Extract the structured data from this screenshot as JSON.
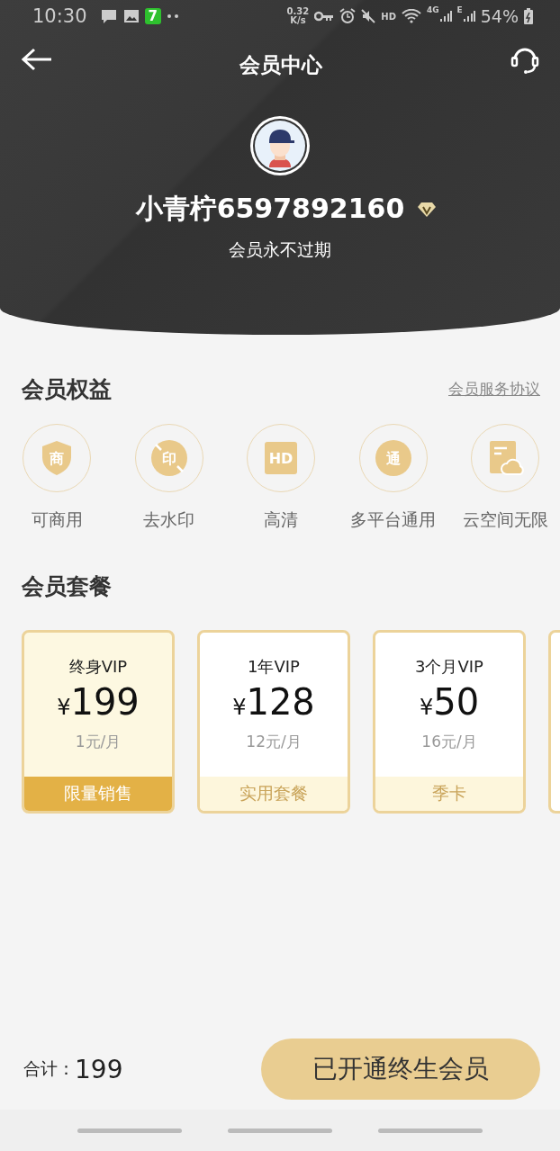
{
  "status_bar": {
    "time": "10:30",
    "notif_badge": "7",
    "speed": "0.32",
    "speed_unit": "K/s",
    "hd": "HD",
    "net": "4G",
    "net2": "E",
    "battery": "54%"
  },
  "header": {
    "title": "会员中心"
  },
  "profile": {
    "name": "小青柠6597892160",
    "expiry": "会员永不过期"
  },
  "benefits": {
    "title": "会员权益",
    "agreement_link": "会员服务协议",
    "items": [
      {
        "kind": "shield",
        "icon_text": "商",
        "label": "可商用"
      },
      {
        "kind": "nomark",
        "icon_text": "印",
        "label": "去水印"
      },
      {
        "kind": "square",
        "icon_text": "HD",
        "label": "高清"
      },
      {
        "kind": "circle",
        "icon_text": "通",
        "label": "多平台通用"
      },
      {
        "kind": "cloud",
        "label": "云空间无限"
      }
    ]
  },
  "plans": {
    "title": "会员套餐",
    "items": [
      {
        "name": "终身VIP",
        "currency": "¥",
        "price": "199",
        "monthly": "1元/月",
        "tag": "限量销售",
        "selected": true
      },
      {
        "name": "1年VIP",
        "currency": "¥",
        "price": "128",
        "monthly": "12元/月",
        "tag": "实用套餐",
        "selected": false
      },
      {
        "name": "3个月VIP",
        "currency": "¥",
        "price": "50",
        "monthly": "16元/月",
        "tag": "季卡",
        "selected": false
      },
      {
        "kind": "partial",
        "selected": false
      }
    ]
  },
  "footer": {
    "total_label": "合计：",
    "total": "199",
    "button": "已开通终生会员"
  }
}
